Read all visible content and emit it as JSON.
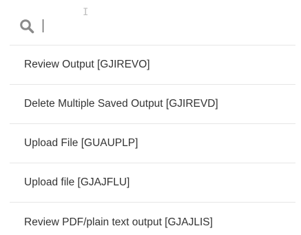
{
  "search": {
    "value": "",
    "icon": "search-icon"
  },
  "menu": {
    "items": [
      {
        "label": "Review Output [GJIREVO]"
      },
      {
        "label": "Delete Multiple Saved Output [GJIREVD]"
      },
      {
        "label": "Upload File [GUAUPLP]"
      },
      {
        "label": "Upload file [GJAJFLU]"
      },
      {
        "label": "Review PDF/plain text output [GJAJLIS]"
      }
    ]
  },
  "colors": {
    "text": "#333333",
    "icon": "#8a8a8a",
    "divider": "#e6e6e6",
    "background": "#ffffff"
  }
}
